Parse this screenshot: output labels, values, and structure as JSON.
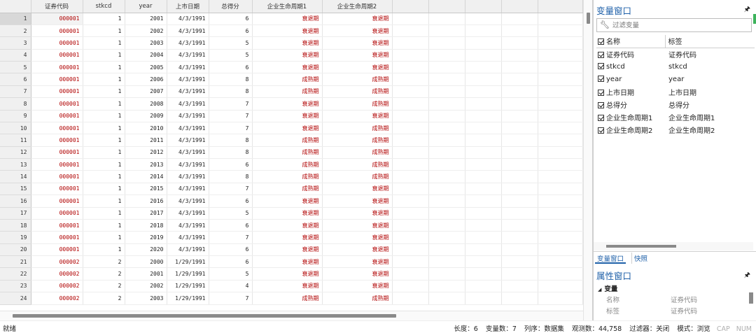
{
  "grid": {
    "columns": [
      "证券代码",
      "stkcd",
      "year",
      "上市日期",
      "总得分",
      "企业生命周期1",
      "企业生命周期2"
    ],
    "rows": [
      {
        "n": "1",
        "code": "000001",
        "stkcd": "1",
        "year": "2001",
        "date": "4/3/1991",
        "score": "6",
        "c1": "衰退期",
        "c2": "衰退期"
      },
      {
        "n": "2",
        "code": "000001",
        "stkcd": "1",
        "year": "2002",
        "date": "4/3/1991",
        "score": "6",
        "c1": "衰退期",
        "c2": "衰退期"
      },
      {
        "n": "3",
        "code": "000001",
        "stkcd": "1",
        "year": "2003",
        "date": "4/3/1991",
        "score": "5",
        "c1": "衰退期",
        "c2": "衰退期"
      },
      {
        "n": "4",
        "code": "000001",
        "stkcd": "1",
        "year": "2004",
        "date": "4/3/1991",
        "score": "5",
        "c1": "衰退期",
        "c2": "衰退期"
      },
      {
        "n": "5",
        "code": "000001",
        "stkcd": "1",
        "year": "2005",
        "date": "4/3/1991",
        "score": "6",
        "c1": "衰退期",
        "c2": "衰退期"
      },
      {
        "n": "6",
        "code": "000001",
        "stkcd": "1",
        "year": "2006",
        "date": "4/3/1991",
        "score": "8",
        "c1": "成熟期",
        "c2": "成熟期"
      },
      {
        "n": "7",
        "code": "000001",
        "stkcd": "1",
        "year": "2007",
        "date": "4/3/1991",
        "score": "8",
        "c1": "成熟期",
        "c2": "成熟期"
      },
      {
        "n": "8",
        "code": "000001",
        "stkcd": "1",
        "year": "2008",
        "date": "4/3/1991",
        "score": "7",
        "c1": "衰退期",
        "c2": "成熟期"
      },
      {
        "n": "9",
        "code": "000001",
        "stkcd": "1",
        "year": "2009",
        "date": "4/3/1991",
        "score": "7",
        "c1": "衰退期",
        "c2": "衰退期"
      },
      {
        "n": "10",
        "code": "000001",
        "stkcd": "1",
        "year": "2010",
        "date": "4/3/1991",
        "score": "7",
        "c1": "衰退期",
        "c2": "成熟期"
      },
      {
        "n": "11",
        "code": "000001",
        "stkcd": "1",
        "year": "2011",
        "date": "4/3/1991",
        "score": "8",
        "c1": "成熟期",
        "c2": "成熟期"
      },
      {
        "n": "12",
        "code": "000001",
        "stkcd": "1",
        "year": "2012",
        "date": "4/3/1991",
        "score": "8",
        "c1": "成熟期",
        "c2": "成熟期"
      },
      {
        "n": "13",
        "code": "000001",
        "stkcd": "1",
        "year": "2013",
        "date": "4/3/1991",
        "score": "6",
        "c1": "成熟期",
        "c2": "成熟期"
      },
      {
        "n": "14",
        "code": "000001",
        "stkcd": "1",
        "year": "2014",
        "date": "4/3/1991",
        "score": "8",
        "c1": "成熟期",
        "c2": "成熟期"
      },
      {
        "n": "15",
        "code": "000001",
        "stkcd": "1",
        "year": "2015",
        "date": "4/3/1991",
        "score": "7",
        "c1": "成熟期",
        "c2": "衰退期"
      },
      {
        "n": "16",
        "code": "000001",
        "stkcd": "1",
        "year": "2016",
        "date": "4/3/1991",
        "score": "6",
        "c1": "衰退期",
        "c2": "衰退期"
      },
      {
        "n": "17",
        "code": "000001",
        "stkcd": "1",
        "year": "2017",
        "date": "4/3/1991",
        "score": "5",
        "c1": "衰退期",
        "c2": "衰退期"
      },
      {
        "n": "18",
        "code": "000001",
        "stkcd": "1",
        "year": "2018",
        "date": "4/3/1991",
        "score": "6",
        "c1": "衰退期",
        "c2": "衰退期"
      },
      {
        "n": "19",
        "code": "000001",
        "stkcd": "1",
        "year": "2019",
        "date": "4/3/1991",
        "score": "7",
        "c1": "衰退期",
        "c2": "衰退期"
      },
      {
        "n": "20",
        "code": "000001",
        "stkcd": "1",
        "year": "2020",
        "date": "4/3/1991",
        "score": "6",
        "c1": "衰退期",
        "c2": "衰退期"
      },
      {
        "n": "21",
        "code": "000002",
        "stkcd": "2",
        "year": "2000",
        "date": "1/29/1991",
        "score": "6",
        "c1": "衰退期",
        "c2": "衰退期"
      },
      {
        "n": "22",
        "code": "000002",
        "stkcd": "2",
        "year": "2001",
        "date": "1/29/1991",
        "score": "5",
        "c1": "衰退期",
        "c2": "衰退期"
      },
      {
        "n": "23",
        "code": "000002",
        "stkcd": "2",
        "year": "2002",
        "date": "1/29/1991",
        "score": "4",
        "c1": "衰退期",
        "c2": "衰退期"
      },
      {
        "n": "24",
        "code": "000002",
        "stkcd": "2",
        "year": "2003",
        "date": "1/29/1991",
        "score": "7",
        "c1": "成熟期",
        "c2": "成熟期"
      }
    ],
    "string_color": "#b00000"
  },
  "variables_panel": {
    "title": "变量窗口",
    "pin_icon": "pin-icon",
    "filter_placeholder": "过滤变量",
    "filter_icon": "wrench-icon",
    "header": {
      "name": "名称",
      "label": "标签"
    },
    "items": [
      {
        "name": "证券代码",
        "label": "证券代码"
      },
      {
        "name": "stkcd",
        "label": "stkcd"
      },
      {
        "name": "year",
        "label": "year"
      },
      {
        "name": "上市日期",
        "label": "上市日期"
      },
      {
        "name": "总得分",
        "label": "总得分"
      },
      {
        "name": "企业生命周期1",
        "label": "企业生命周期1"
      },
      {
        "name": "企业生命周期2",
        "label": "企业生命周期2"
      }
    ],
    "tabs": [
      "变量窗口",
      "快照"
    ]
  },
  "properties_panel": {
    "title": "属性窗口",
    "group": "变量",
    "rows": [
      {
        "key": "名称",
        "value": "证券代码"
      },
      {
        "key": "标签",
        "value": "证券代码"
      }
    ]
  },
  "status": {
    "left": "就绪",
    "items": [
      "长度：6",
      "变量数：7",
      "列序：数据集",
      "观测数：44,758",
      "过滤器：关闭",
      "模式：浏览"
    ],
    "dim_items": [
      "CAP",
      "NUM"
    ]
  },
  "accent_color": "#1d5fa8"
}
